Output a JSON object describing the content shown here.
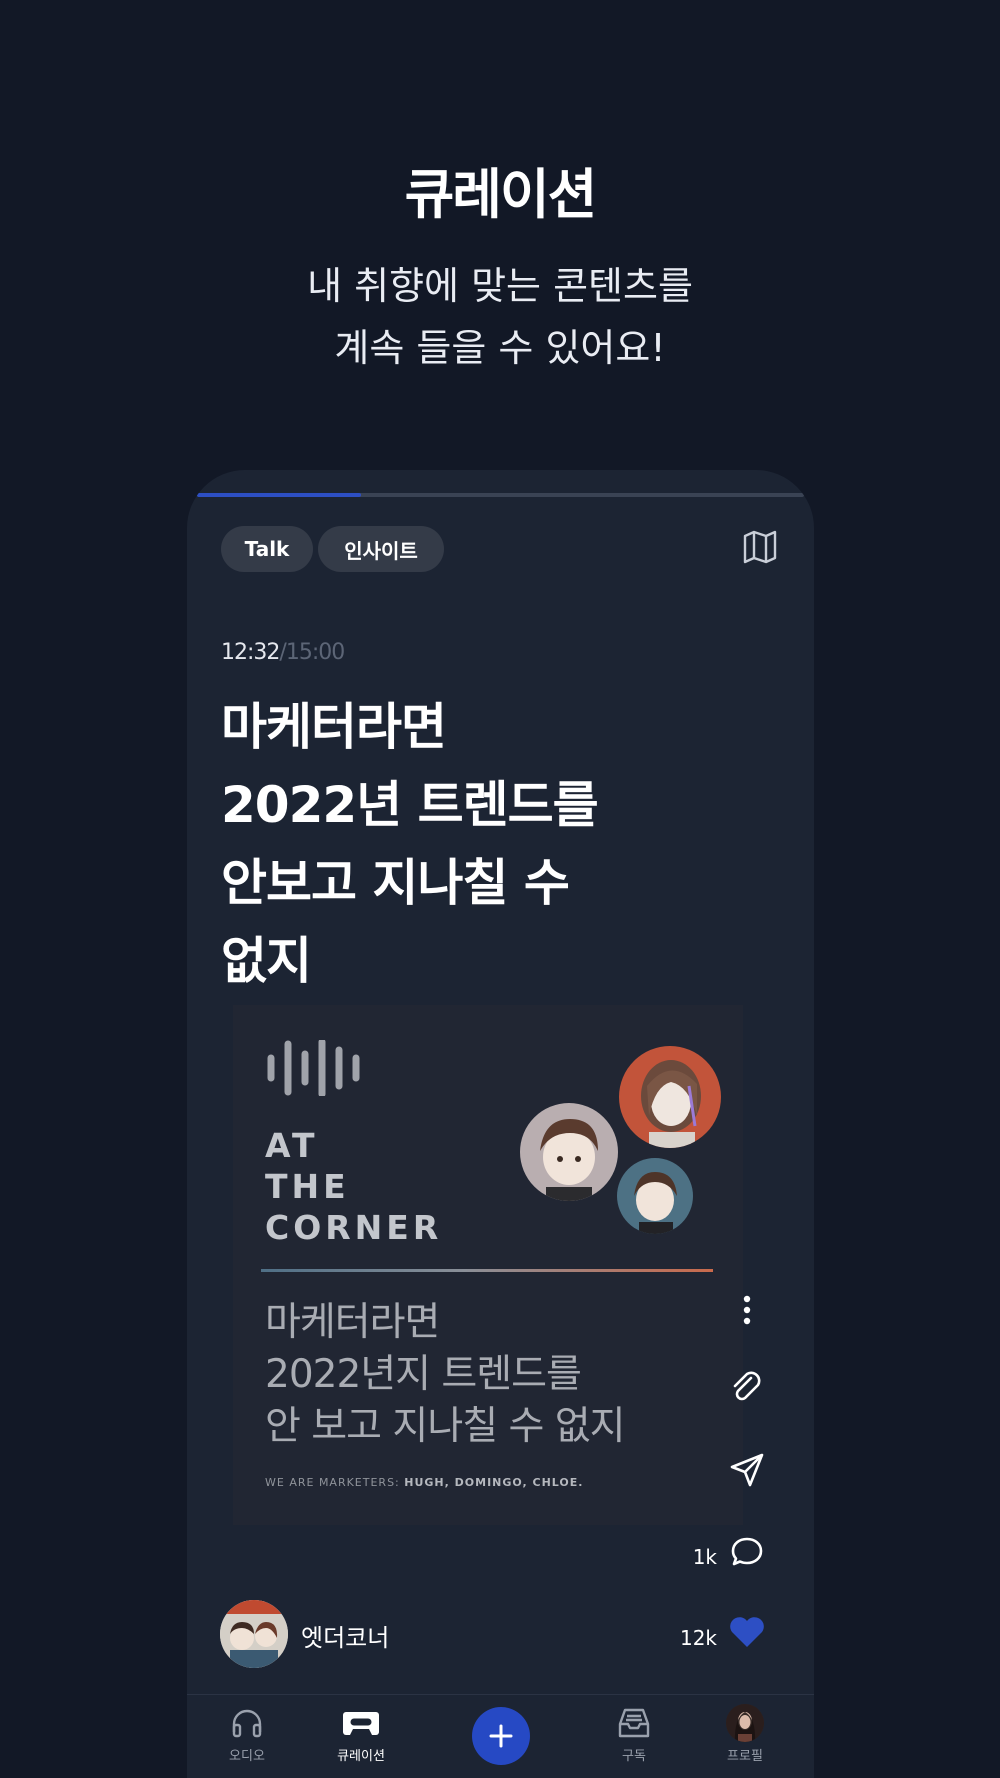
{
  "hero": {
    "title": "큐레이션",
    "subtitle_line1": "내 취향에 맞는 콘텐츠를",
    "subtitle_line2": "계속 들을 수 있어요!"
  },
  "player": {
    "progress": 0.27,
    "tags": [
      "Talk",
      "인사이트"
    ],
    "time_current": "12:32",
    "time_separator": "/",
    "time_total": "15:00",
    "title_lines": [
      "마케터라면",
      "2022년 트렌드를",
      "안보고 지나칠 수",
      "없지"
    ],
    "artwork": {
      "logo_lines": [
        "AT",
        "THE",
        "CORNER"
      ],
      "text_lines": [
        "마케터라면",
        "2022년지 트렌드를",
        "안 보고 지나칠 수 없지"
      ],
      "credits_prefix": "WE ARE MARKETERS: ",
      "credits_names": "HUGH, DOMINGO, CHLOE."
    },
    "comment_count": "1k",
    "like_count": "12k",
    "channel_name": "엣더코너"
  },
  "tabbar": {
    "items": [
      {
        "label": "오디오",
        "icon": "headphones-icon"
      },
      {
        "label": "큐레이션",
        "icon": "cassette-icon",
        "active": true
      },
      {
        "label": "",
        "icon": "plus-icon"
      },
      {
        "label": "구독",
        "icon": "inbox-icon"
      },
      {
        "label": "프로필",
        "icon": "profile-avatar"
      }
    ]
  },
  "colors": {
    "background": "#121826",
    "card": "#1c2433",
    "accent": "#2649c4",
    "like": "#2d4fc4"
  }
}
